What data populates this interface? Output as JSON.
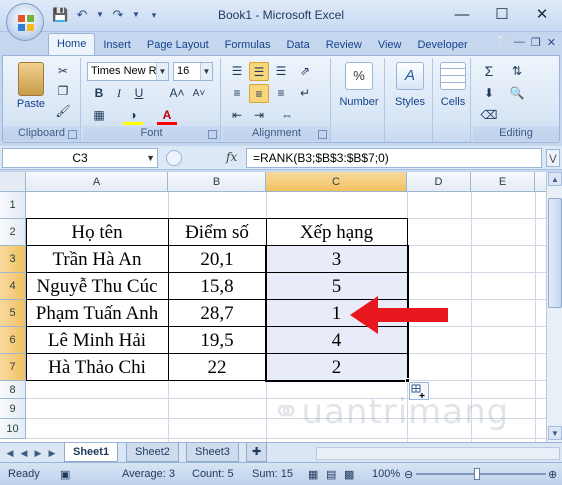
{
  "window": {
    "title": "Book1 - Microsoft Excel",
    "controls": [
      "—",
      "☐",
      "✕"
    ]
  },
  "ribbon": {
    "tabs": [
      "Home",
      "Insert",
      "Page Layout",
      "Formulas",
      "Data",
      "Review",
      "View",
      "Developer"
    ],
    "active_tab": "Home",
    "groups": {
      "clipboard": {
        "label": "Clipboard",
        "paste": "Paste"
      },
      "font": {
        "label": "Font",
        "font_name": "Times New Rc",
        "font_size": "16",
        "bold": "B",
        "italic": "I",
        "underline": "U"
      },
      "alignment": {
        "label": "Alignment"
      },
      "number": {
        "label": "Number",
        "button": "Number",
        "percent": "%"
      },
      "styles": {
        "button": "Styles"
      },
      "cells": {
        "button": "Cells"
      },
      "editing": {
        "label": "Editing"
      }
    }
  },
  "formula_bar": {
    "name_box": "C3",
    "fx": "fx",
    "formula": "=RANK(B3;$B$3:$B$7;0)"
  },
  "grid": {
    "columns": [
      "A",
      "B",
      "C",
      "D",
      "E"
    ],
    "rows": [
      "1",
      "2",
      "3",
      "4",
      "5",
      "6",
      "7",
      "8",
      "9",
      "10"
    ],
    "selected_column": "C",
    "headers": {
      "a": "Họ tên",
      "b": "Điểm số",
      "c": "Xếp hạng"
    },
    "data": [
      {
        "name": "Trần Hà An",
        "score": "20,1",
        "rank": "3"
      },
      {
        "name": "Nguyễ Thu Cúc",
        "score": "15,8",
        "rank": "5"
      },
      {
        "name": "Phạm Tuấn Anh",
        "score": "28,7",
        "rank": "1"
      },
      {
        "name": "Lê Minh Hải",
        "score": "19,5",
        "rank": "4"
      },
      {
        "name": "Hà Thảo Chi",
        "score": "22",
        "rank": "2"
      }
    ],
    "arrow_color": "#e8171e"
  },
  "sheets": {
    "tabs": [
      "Sheet1",
      "Sheet2",
      "Sheet3"
    ],
    "active": "Sheet1"
  },
  "status": {
    "mode": "Ready",
    "average": "Average: 3",
    "count": "Count: 5",
    "sum": "Sum: 15",
    "zoom": "100%"
  }
}
